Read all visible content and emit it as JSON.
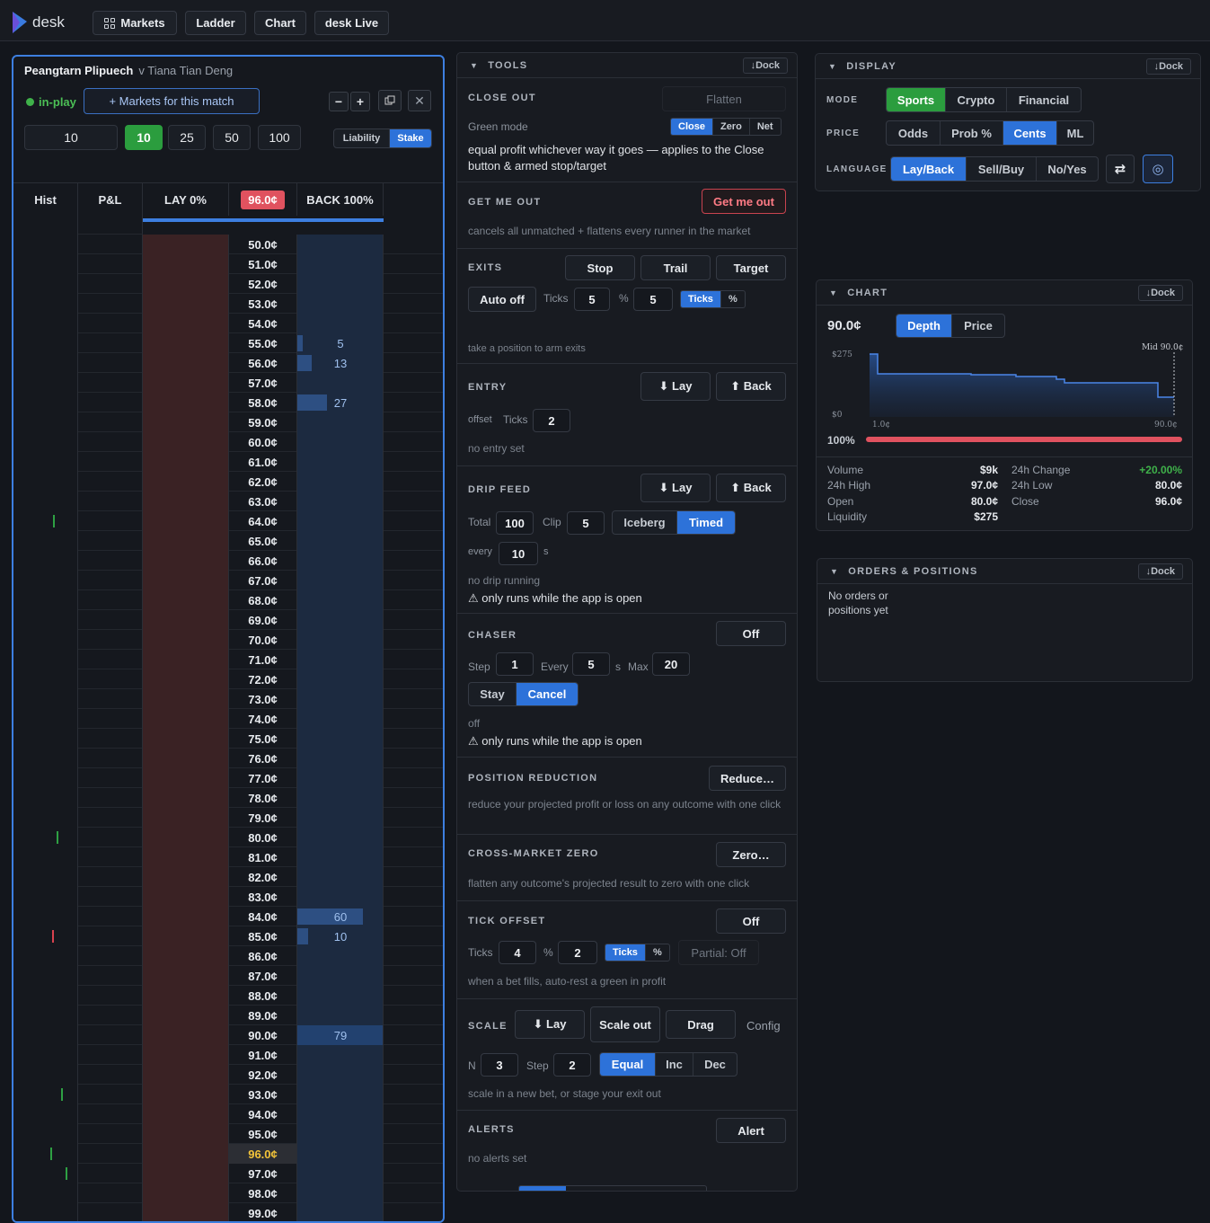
{
  "app": {
    "name": "desk"
  },
  "nav": {
    "markets": "Markets",
    "ladder": "Ladder",
    "chart": "Chart",
    "live": "desk Live"
  },
  "match": {
    "home": "Peangtarn Plipuech",
    "away": "v Tiana Tian Deng",
    "status": "in-play",
    "markets_btn": "+ Markets for this match"
  },
  "controls": {
    "minus": "−",
    "plus": "+",
    "close": "✕"
  },
  "stakes": {
    "input": "10",
    "presets": [
      "10",
      "25",
      "50",
      "100"
    ],
    "liability": "Liability",
    "stake": "Stake"
  },
  "ladder": {
    "headers": {
      "hist": "Hist",
      "pl": "P&L",
      "lay": "LAY 0%",
      "ltp": "96.0¢",
      "back": "BACK 100%"
    },
    "prices": [
      "50.0¢",
      "51.0¢",
      "52.0¢",
      "53.0¢",
      "54.0¢",
      "55.0¢",
      "56.0¢",
      "57.0¢",
      "58.0¢",
      "59.0¢",
      "60.0¢",
      "61.0¢",
      "62.0¢",
      "63.0¢",
      "64.0¢",
      "65.0¢",
      "66.0¢",
      "67.0¢",
      "68.0¢",
      "69.0¢",
      "70.0¢",
      "71.0¢",
      "72.0¢",
      "73.0¢",
      "74.0¢",
      "75.0¢",
      "76.0¢",
      "77.0¢",
      "78.0¢",
      "79.0¢",
      "80.0¢",
      "81.0¢",
      "82.0¢",
      "83.0¢",
      "84.0¢",
      "85.0¢",
      "86.0¢",
      "87.0¢",
      "88.0¢",
      "89.0¢",
      "90.0¢",
      "91.0¢",
      "92.0¢",
      "93.0¢",
      "94.0¢",
      "95.0¢",
      "96.0¢",
      "97.0¢",
      "98.0¢",
      "99.0¢"
    ],
    "back_volumes": {
      "5": "5",
      "6": "13",
      "8": "27",
      "34": "60",
      "35": "10",
      "40": "79"
    },
    "highlight_index": 46
  },
  "tools": {
    "title": "TOOLS",
    "dock": "↓Dock",
    "close_out": {
      "title": "CLOSE OUT",
      "flatten": "Flatten",
      "green_mode": "Green mode",
      "modes": [
        "Close",
        "Zero",
        "Net"
      ],
      "desc": "equal profit whichever way it goes — applies to the Close button & armed stop/target"
    },
    "get_me_out": {
      "title": "GET ME OUT",
      "button": "Get me out",
      "desc": "cancels all unmatched + flattens every runner in the market"
    },
    "exits": {
      "title": "EXITS",
      "buttons": [
        "Stop",
        "Trail",
        "Target"
      ],
      "auto": "Auto off",
      "ticks_label": "Ticks",
      "ticks": "5",
      "pct_label": "%",
      "pct": "5",
      "toggle": [
        "Ticks",
        "%"
      ],
      "desc": "take a position to arm exits"
    },
    "entry": {
      "title": "ENTRY",
      "lay": "⬇ Lay",
      "back": "⬆ Back",
      "offset": "offset",
      "ticks_label": "Ticks",
      "ticks": "2",
      "desc": "no entry set"
    },
    "drip": {
      "title": "DRIP FEED",
      "lay": "⬇ Lay",
      "back": "⬆ Back",
      "total_label": "Total",
      "total": "100",
      "clip_label": "Clip",
      "clip": "5",
      "modes": [
        "Iceberg",
        "Timed"
      ],
      "every_label": "every",
      "every": "10",
      "s": "s",
      "desc": "no drip running",
      "warn": "⚠ only runs while the app is open"
    },
    "chaser": {
      "title": "CHASER",
      "off": "Off",
      "step_label": "Step",
      "step": "1",
      "every_label": "Every",
      "every": "5",
      "s": "s",
      "max_label": "Max",
      "max": "20",
      "modes": [
        "Stay",
        "Cancel"
      ],
      "desc": "off",
      "warn": "⚠ only runs while the app is open"
    },
    "reduction": {
      "title": "POSITION REDUCTION",
      "button": "Reduce…",
      "desc": "reduce your projected profit or loss on any outcome with one click"
    },
    "xzero": {
      "title": "CROSS-MARKET ZERO",
      "button": "Zero…",
      "desc": "flatten any outcome's projected result to zero with one click"
    },
    "tick_offset": {
      "title": "TICK OFFSET",
      "off": "Off",
      "ticks_label": "Ticks",
      "ticks": "4",
      "pct_label": "%",
      "pct": "2",
      "toggle": [
        "Ticks",
        "%"
      ],
      "partial": "Partial: Off",
      "desc": "when a bet fills, auto-rest a green in profit"
    },
    "scale": {
      "title": "SCALE",
      "lay": "⬇ Lay",
      "scale_out": "Scale out",
      "drag": "Drag",
      "config": "Config",
      "n_label": "N",
      "n": "3",
      "step_label": "Step",
      "step": "2",
      "modes": [
        "Equal",
        "Inc",
        "Dec"
      ],
      "desc": "scale in a new bet, or stage your exit out"
    },
    "alerts": {
      "title": "ALERTS",
      "button": "Alert",
      "desc": "no alerts set"
    }
  },
  "display": {
    "title": "DISPLAY",
    "dock": "↓Dock",
    "mode_label": "MODE",
    "modes": [
      "Sports",
      "Crypto",
      "Financial"
    ],
    "price_label": "PRICE",
    "prices": [
      "Odds",
      "Prob %",
      "Cents",
      "ML"
    ],
    "lang_label": "LANGUAGE",
    "langs": [
      "Lay/Back",
      "Sell/Buy",
      "No/Yes"
    ],
    "swap": "⇄",
    "circle": "◎"
  },
  "chart": {
    "title": "CHART",
    "dock": "↓Dock",
    "price": "90.0¢",
    "tabs": [
      "Depth",
      "Price"
    ],
    "y_top": "$275",
    "y_bottom": "$0",
    "x_left": "1.0¢",
    "x_right": "90.0¢",
    "mid": "Mid 90.0¢",
    "pct": "100%",
    "stats": [
      {
        "k": "Volume",
        "v": "$9k"
      },
      {
        "k": "24h Change",
        "v": "+20.00%"
      },
      {
        "k": "24h High",
        "v": "97.0¢"
      },
      {
        "k": "24h Low",
        "v": "80.0¢"
      },
      {
        "k": "Open",
        "v": "80.0¢"
      },
      {
        "k": "Close",
        "v": "96.0¢"
      },
      {
        "k": "Liquidity",
        "v": "$275"
      }
    ]
  },
  "orders": {
    "title": "ORDERS & POSITIONS",
    "dock": "↓Dock",
    "empty": "No orders or positions yet"
  },
  "colors": {
    "accent": "#2d72d9",
    "green": "#2b9d3e",
    "red": "#e0525f"
  }
}
